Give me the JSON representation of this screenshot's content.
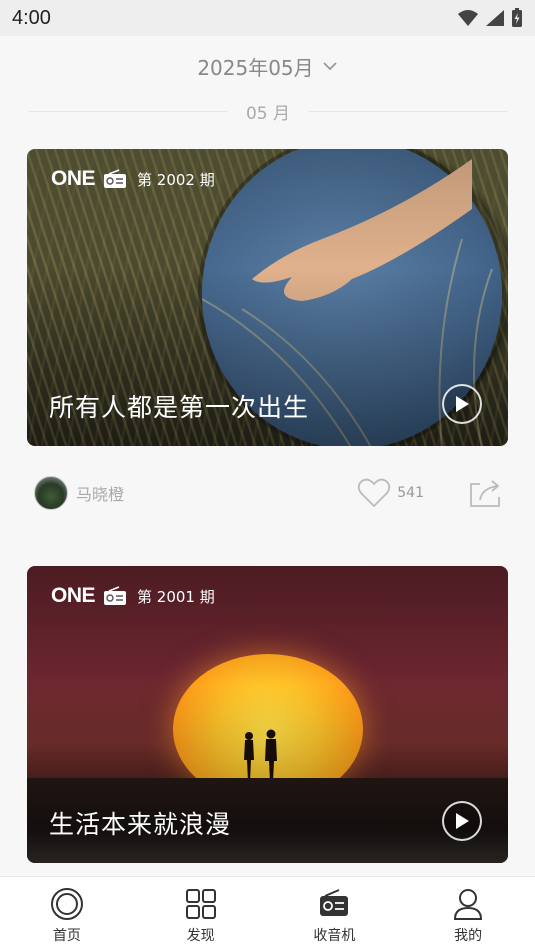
{
  "status_bar": {
    "time": "4:00"
  },
  "month_picker": {
    "label": "2025年05月",
    "icon": "chevron-down-icon"
  },
  "month_divider": {
    "label": "05 月"
  },
  "cards": [
    {
      "logo": "ONE",
      "issue": "第 2002 期",
      "title": "所有人都是第一次出生",
      "author": "马晓橙",
      "likes": "541"
    },
    {
      "logo": "ONE",
      "issue": "第 2001 期",
      "title": "生活本来就浪漫"
    }
  ],
  "bottom_nav": {
    "items": [
      {
        "label": "首页",
        "icon": "home-circle-icon"
      },
      {
        "label": "发现",
        "icon": "grid-icon"
      },
      {
        "label": "收音机",
        "icon": "radio-icon"
      },
      {
        "label": "我的",
        "icon": "person-icon"
      }
    ]
  }
}
